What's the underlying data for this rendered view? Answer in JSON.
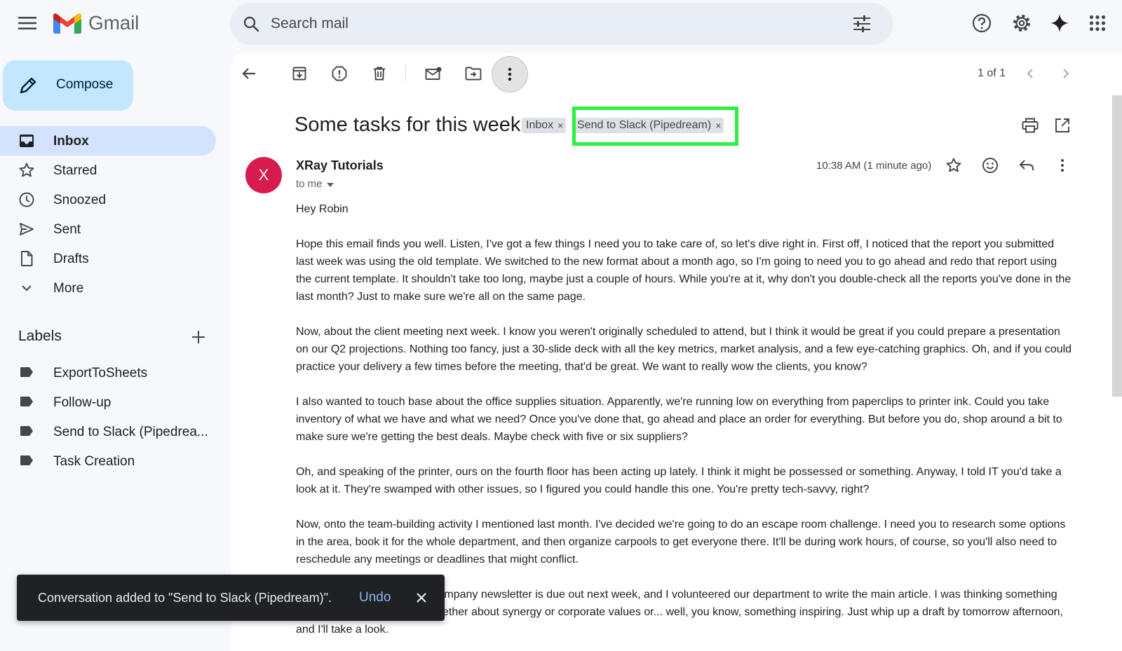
{
  "app": {
    "name": "Gmail"
  },
  "search": {
    "placeholder": "Search mail"
  },
  "compose": {
    "label": "Compose"
  },
  "nav": [
    {
      "label": "Inbox",
      "icon": "inbox-icon"
    },
    {
      "label": "Starred",
      "icon": "star-icon"
    },
    {
      "label": "Snoozed",
      "icon": "clock-icon"
    },
    {
      "label": "Sent",
      "icon": "send-icon"
    },
    {
      "label": "Drafts",
      "icon": "draft-icon"
    },
    {
      "label": "More",
      "icon": "chevron-down-icon"
    }
  ],
  "labels": {
    "heading": "Labels",
    "items": [
      {
        "label": "ExportToSheets"
      },
      {
        "label": "Follow-up"
      },
      {
        "label": "Send to Slack (Pipedrea..."
      },
      {
        "label": "Task Creation"
      }
    ]
  },
  "toolbar": {
    "pager": "1 of 1"
  },
  "email": {
    "subject": "Some tasks for this week",
    "chips": [
      {
        "label": "Inbox",
        "close": "×"
      },
      {
        "label": "Send to Slack (Pipedream)",
        "close": "×"
      }
    ],
    "avatar_letter": "X",
    "avatar_color": "#d81b4f",
    "sender": "XRay Tutorials",
    "to": "to me",
    "time": "10:38 AM (1 minute ago)",
    "greeting": "Hey Robin",
    "paragraphs": [
      "Hope this email finds you well. Listen, I've got a few things I need you to take care of, so let's dive right in. First off, I noticed that the report you submitted last week was using the old template. We switched to the new format about a month ago, so I'm going to need you to go ahead and redo that report using the current template. It shouldn't take too long, maybe just a couple of hours. While you're at it, why don't you double-check all the reports you've done in the last month? Just to make sure we're all on the same page.",
      "Now, about the client meeting next week. I know you weren't originally scheduled to attend, but I think it would be great if you could prepare a presentation on our Q2 projections. Nothing too fancy, just a 30-slide deck with all the key metrics, market analysis, and a few eye-catching graphics. Oh, and if you could practice your delivery a few times before the meeting, that'd be great. We want to really wow the clients, you know?",
      "I also wanted to touch base about the office supplies situation. Apparently, we're running low on everything from paperclips to printer ink. Could you take inventory of what we have and what we need? Once you've done that, go ahead and place an order for everything. But before you do, shop around a bit to make sure we're getting the best deals. Maybe check with five or six suppliers?",
      "Oh, and speaking of the printer, ours on the fourth floor has been acting up lately. I think it might be possessed or something. Anyway, I told IT you'd take a look at it. They're swamped with other issues, so I figured you could handle this one. You're pretty tech-savvy, right?",
      "Now, onto the team-building activity I mentioned last month. I've decided we're going to do an escape room challenge. I need you to research some options in the area, book it for the whole department, and then organize carpools to get everyone there. It'll be during work hours, of course, so you'll also need to reschedule any meetings or deadlines that might conflict.",
      "Oh, and almost forgot. The company newsletter is due out next week, and I volunteered our department to write the main article. I was thinking something along the lines of bringing together about synergy or corporate values or... well, you know, something inspiring. Just whip up a draft by tomorrow afternoon, and I'll take a look."
    ]
  },
  "snackbar": {
    "message": "Conversation added to \"Send to Slack (Pipedream)\".",
    "action": "Undo"
  },
  "colors": {
    "accent_highlight": "#2ef044",
    "compose_bg": "#c2e7ff",
    "active_nav": "#d3e3fd"
  }
}
